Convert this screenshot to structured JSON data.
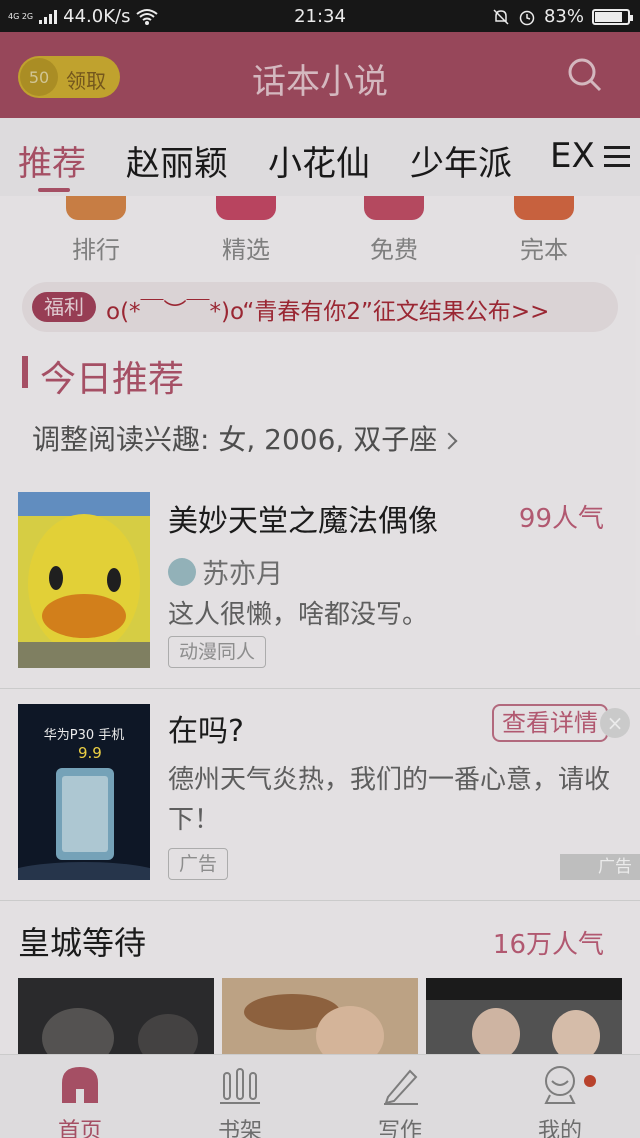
{
  "status_bar": {
    "network_tags": "4G 2G",
    "speed": "44.0K/s",
    "time": "21:34",
    "battery": "83%"
  },
  "header": {
    "coin_value": "50",
    "claim_label": "领取",
    "title": "话本小说",
    "accent": "#a44e62"
  },
  "tabs": [
    "推荐",
    "赵丽颖",
    "小花仙",
    "少年派",
    "EX"
  ],
  "categories": [
    "排行",
    "精选",
    "免费",
    "完本"
  ],
  "banner": {
    "tag": "福利",
    "text": "o(*￣︶￣*)o“青春有你2”征文结果公布>>"
  },
  "section": {
    "title": "今日推荐",
    "interest": "调整阅读兴趣: 女, 2006, 双子座"
  },
  "books": [
    {
      "title": "美妙天堂之魔法偶像",
      "popularity": "99人气",
      "author": "苏亦月",
      "description": "这人很懒，啥都没写。",
      "tag": "动漫同人"
    }
  ],
  "ad": {
    "title": "在吗?",
    "button": "查看详情",
    "close": "×",
    "description": "德州天气炎热，我们的一番心意，请收下！",
    "tag": "广告",
    "corner_label": "广告",
    "cover_line1": "华为P30 手机",
    "cover_line2": "9.9"
  },
  "collection": {
    "title": "皇城等待",
    "popularity": "16万人气"
  },
  "bottom_nav": [
    "首页",
    "书架",
    "写作",
    "我的"
  ]
}
